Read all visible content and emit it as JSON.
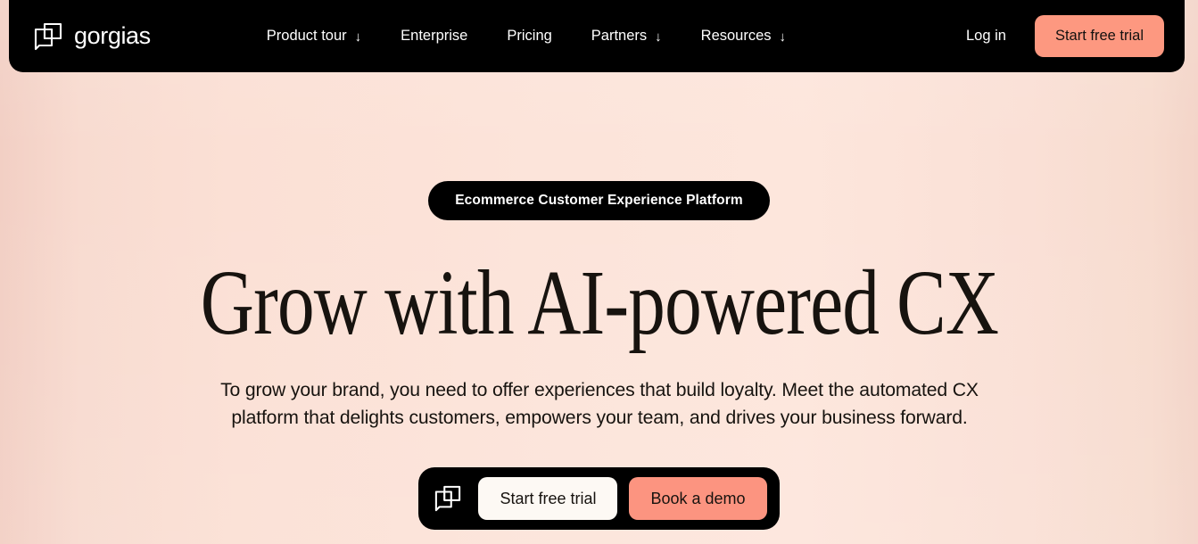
{
  "brand": {
    "name": "gorgias",
    "logo_icon": "gorgias-speech-bubble-squares-icon"
  },
  "nav": {
    "links": [
      {
        "label": "Product tour",
        "caret": "↓",
        "has_dropdown": true
      },
      {
        "label": "Enterprise",
        "caret": "",
        "has_dropdown": false
      },
      {
        "label": "Pricing",
        "caret": "",
        "has_dropdown": false
      },
      {
        "label": "Partners",
        "caret": "↓",
        "has_dropdown": true
      },
      {
        "label": "Resources",
        "caret": "↓",
        "has_dropdown": true
      }
    ],
    "login_label": "Log in",
    "cta_label": "Start free trial"
  },
  "hero": {
    "badge": "Ecommerce Customer Experience Platform",
    "headline": "Grow with AI-powered CX",
    "subheading": "To grow your brand, you need to offer experiences that build loyalty. Meet the automated CX platform that delights customers, empowers your team, and drives your business forward.",
    "cta": {
      "logo_icon": "gorgias-speech-bubble-squares-icon",
      "primary_label": "Start free trial",
      "secondary_label": "Book a demo"
    }
  },
  "colors": {
    "nav_background": "#000000",
    "page_background": "#fce4da",
    "page_background_edge": "#f2cfc4",
    "accent_coral": "#fd9880",
    "cta_light": "#fdf9f4",
    "text_dark": "#17130f",
    "text_light": "#ffffff"
  }
}
